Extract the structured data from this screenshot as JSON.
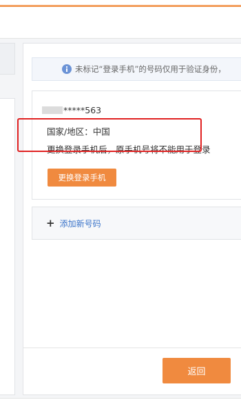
{
  "notice": {
    "text": "未标记“登录手机”的号码仅用于验证身份，",
    "icon": "info-icon",
    "icon_color": "#6b93d6"
  },
  "phone_card": {
    "number_suffix": "*****563",
    "region": "国家/地区：中国",
    "warning": "更换登录手机后，原手机号将不能用于登录",
    "change_button": "更换登录手机",
    "highlight_color": "#e02020"
  },
  "add_number": {
    "icon": "plus-icon",
    "label": "添加新号码",
    "link_color": "#3a73c9"
  },
  "footer": {
    "back_button": "返回"
  },
  "colors": {
    "accent": "#f08a3f",
    "background": "#f4f5f7"
  }
}
